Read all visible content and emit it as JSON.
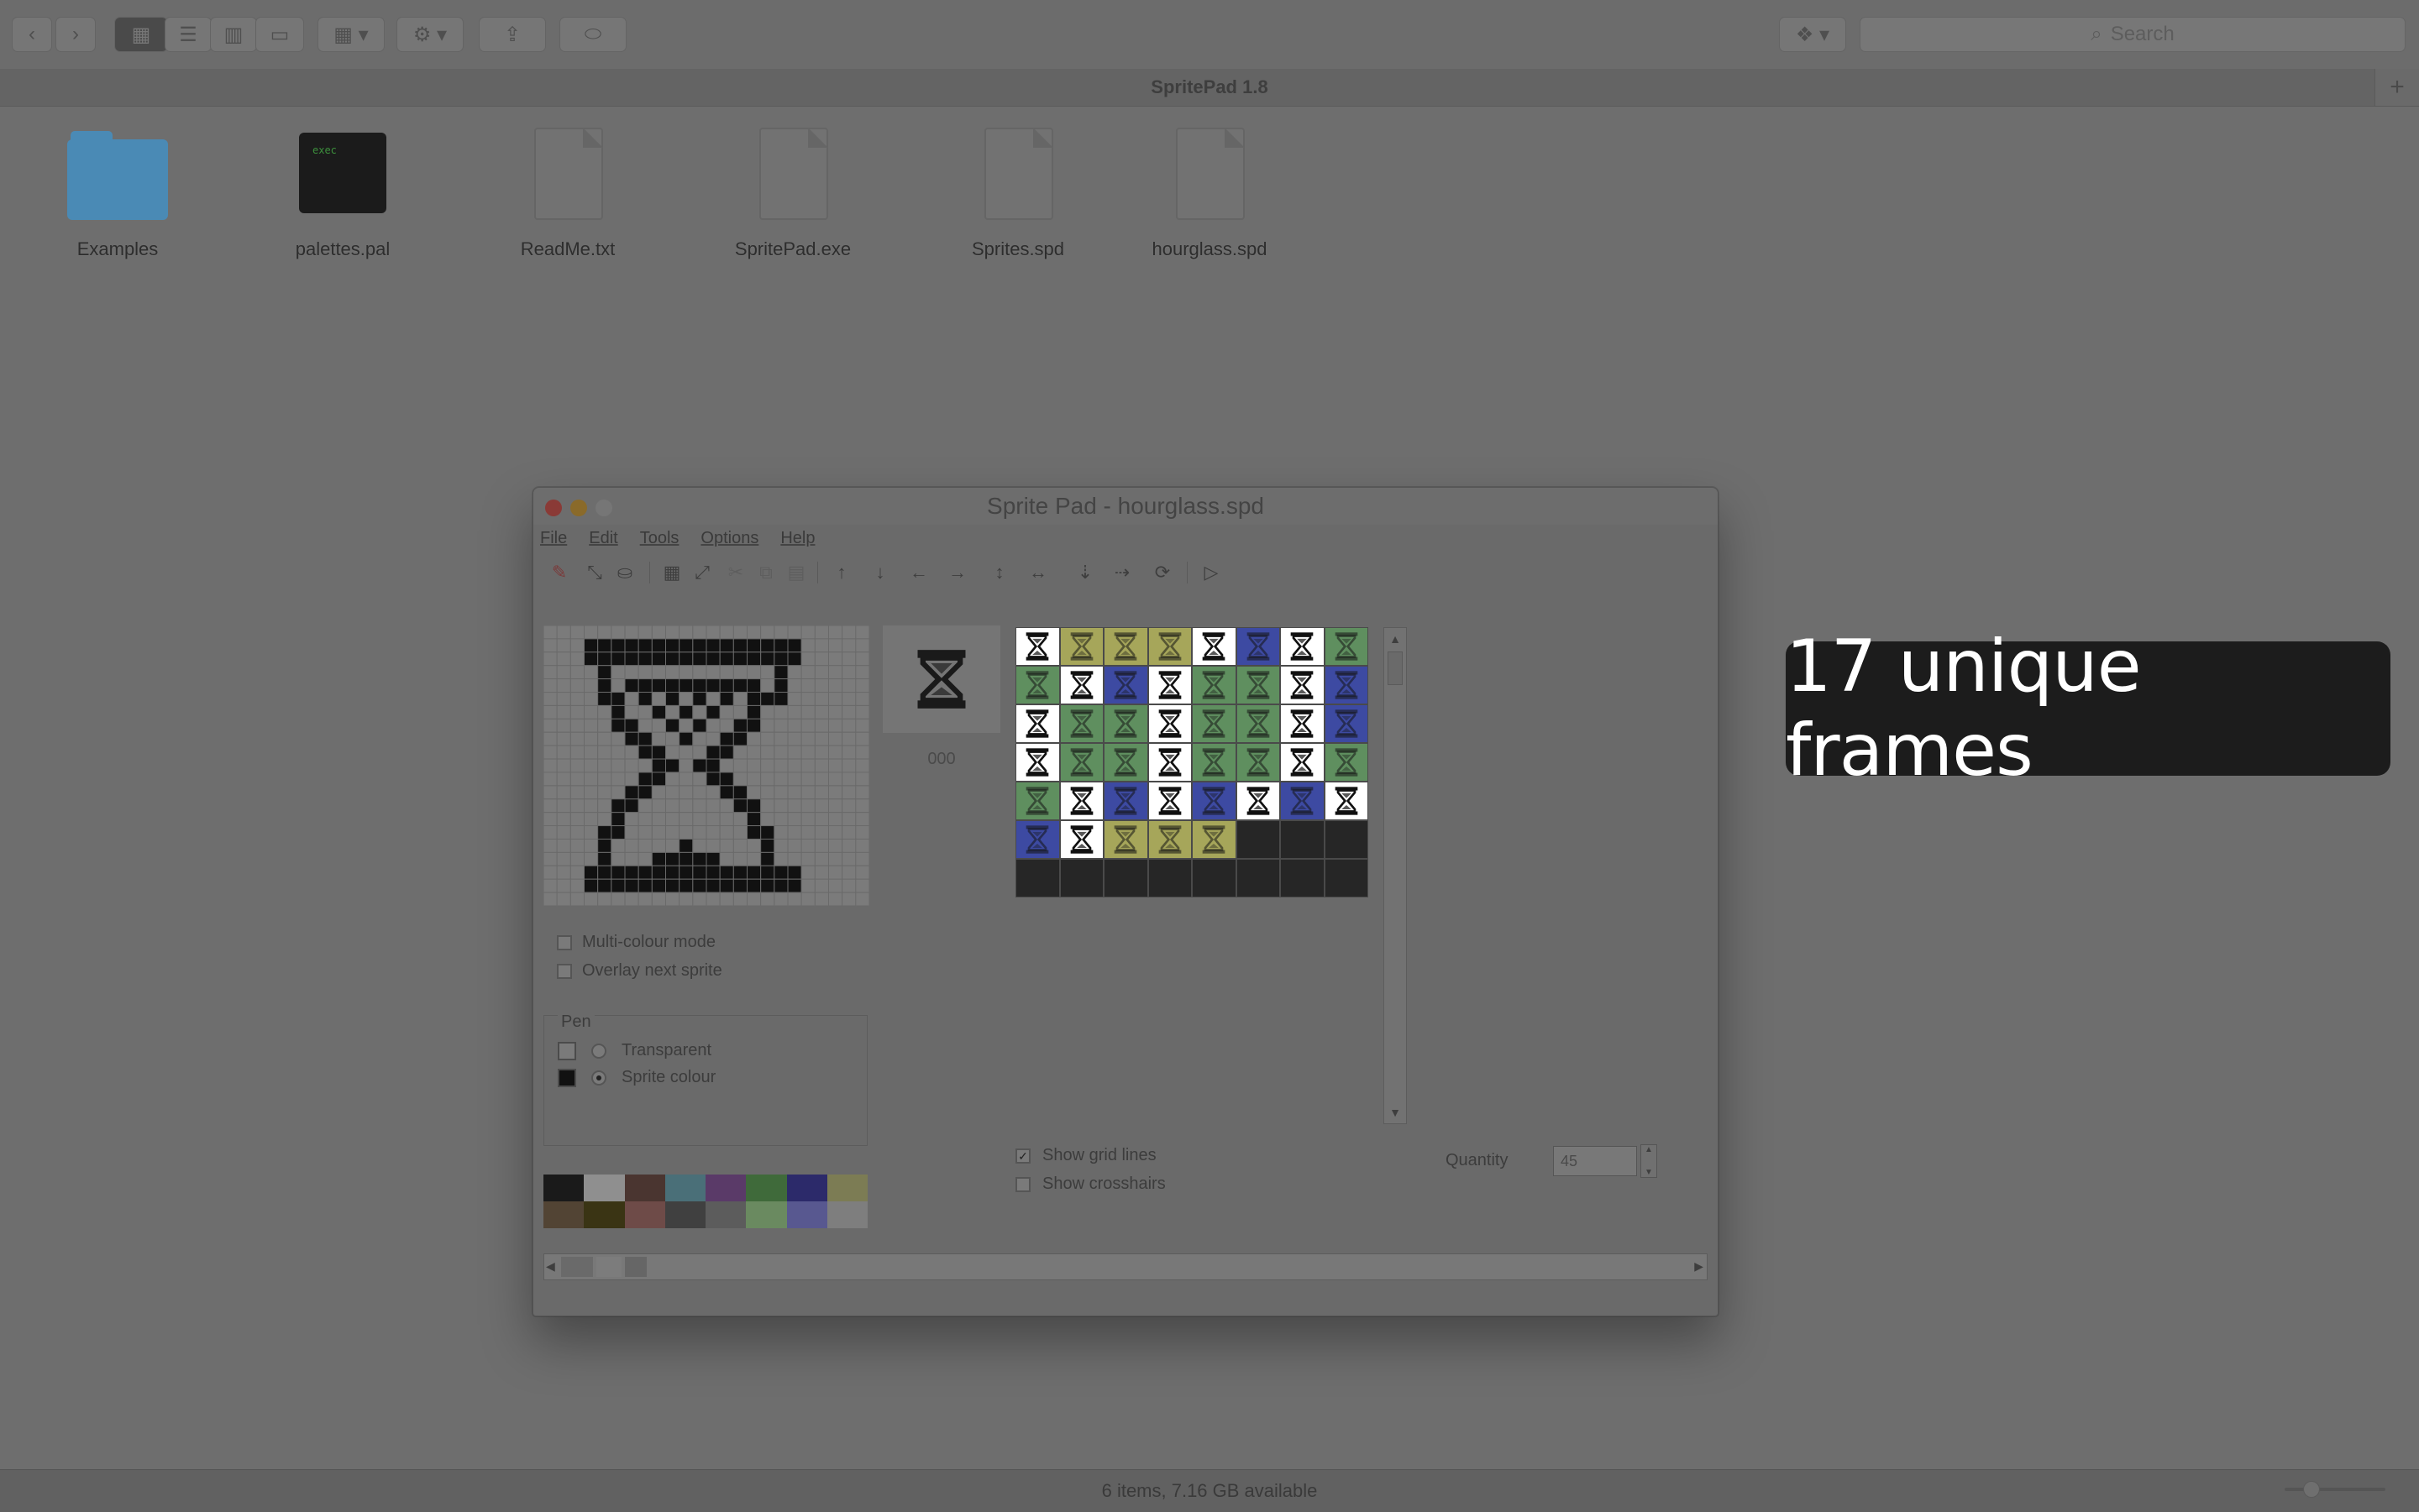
{
  "finder": {
    "toolbar": {
      "back_icon": "chevron-left-icon",
      "forward_icon": "chevron-right-icon",
      "view_icons": [
        "icon-view-icon",
        "list-view-icon",
        "column-view-icon",
        "cover-flow-icon"
      ],
      "arrange_icon": "arrange-icon",
      "action_icon": "gear-icon",
      "share_icon": "share-icon",
      "tag_icon": "tag-icon",
      "dropbox_icon": "dropbox-icon",
      "search_placeholder": "Search"
    },
    "path_title": "SpritePad 1.8",
    "files": [
      {
        "name": "Examples",
        "kind": "folder"
      },
      {
        "name": "palettes.pal",
        "kind": "terminal"
      },
      {
        "name": "ReadMe.txt",
        "kind": "text"
      },
      {
        "name": "SpritePad.exe",
        "kind": "document"
      },
      {
        "name": "Sprites.spd",
        "kind": "document"
      },
      {
        "name": "hourglass.spd",
        "kind": "document"
      }
    ],
    "status": "6 items, 7.16 GB available"
  },
  "spritepad": {
    "title": "Sprite Pad - hourglass.spd",
    "menus": [
      "File",
      "Edit",
      "Tools",
      "Options",
      "Help"
    ],
    "preview_index": "000",
    "options": {
      "multicolour": "Multi-colour mode",
      "overlay": "Overlay next sprite"
    },
    "pen": {
      "title": "Pen",
      "transparent": "Transparent",
      "sprite_colour": "Sprite colour",
      "selected": "Sprite colour"
    },
    "palette": [
      "#1a1a1a",
      "#8f8f8f",
      "#4a3530",
      "#4a6f78",
      "#5a3a68",
      "#3f6a3a",
      "#2c2a6a",
      "#7c7c54",
      "#524434",
      "#3a3414",
      "#6e4b48",
      "#404040",
      "#5c5c5c",
      "#6a8a60",
      "#585890",
      "#7e7e7e"
    ],
    "sheet": {
      "colors": {
        "W": "#ffffff",
        "Y": "#a6a65a",
        "G": "#5f8f5f",
        "B": "#3d4aa2",
        "D": "#262626"
      },
      "grid": [
        [
          "W",
          "Y",
          "Y",
          "Y",
          "W",
          "B",
          "W",
          "G"
        ],
        [
          "G",
          "W",
          "B",
          "W",
          "G",
          "G",
          "W",
          "B"
        ],
        [
          "W",
          "G",
          "G",
          "W",
          "G",
          "G",
          "W",
          "B"
        ],
        [
          "W",
          "G",
          "G",
          "W",
          "G",
          "G",
          "W",
          "G"
        ],
        [
          "G",
          "W",
          "B",
          "W",
          "B",
          "W",
          "B",
          "W"
        ],
        [
          "B",
          "W",
          "Y",
          "Y",
          "Y",
          "D",
          "D",
          "D"
        ],
        [
          "D",
          "D",
          "D",
          "D",
          "D",
          "D",
          "D",
          "D"
        ]
      ]
    },
    "show_grid_lines": "Show grid lines",
    "show_crosshairs": "Show crosshairs",
    "quantity_label": "Quantity",
    "quantity_value": "45"
  },
  "caption": "17 unique frames"
}
